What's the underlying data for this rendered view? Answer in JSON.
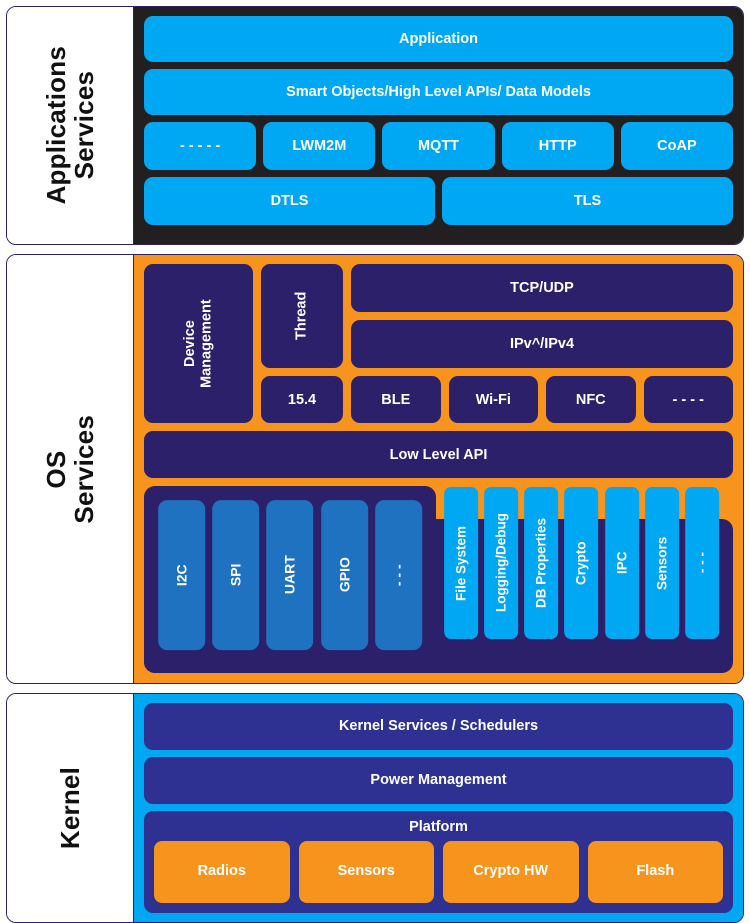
{
  "colors": {
    "cyan": "#00a8f3",
    "orange": "#f7941e",
    "navy": "#2b2069",
    "kernel_navy": "#2e3192",
    "peripheral_blue": "#1f72c0",
    "dark": "#231f20",
    "white": "#ffffff"
  },
  "layers": {
    "applications": {
      "label": "Applications\nServices",
      "application": "Application",
      "smart_objects": "Smart Objects/High Level APIs/ Data Models",
      "protocols": [
        "- - - - -",
        "LWM2M",
        "MQTT",
        "HTTP",
        "CoAP"
      ],
      "security": [
        "DTLS",
        "TLS"
      ]
    },
    "os": {
      "label": "OS\nServices",
      "device_management": "Device\nManagement",
      "thread": "Thread",
      "mac_154": "15.4",
      "transport": "TCP/UDP",
      "network": "IPv^/IPv4",
      "radios": [
        "BLE",
        "Wi-Fi",
        "NFC",
        "- - - -"
      ],
      "low_level_api": "Low Level API",
      "peripherals": [
        "I2C",
        "SPI",
        "UART",
        "GPIO",
        "- - -"
      ],
      "services": [
        "File System",
        "Logging/Debug",
        "DB Properties",
        "Crypto",
        "IPC",
        "Sensors",
        "- - -"
      ]
    },
    "kernel": {
      "label": "Kernel",
      "kernel_services": "Kernel Services / Schedulers",
      "power_management": "Power Management",
      "platform_title": "Platform",
      "platform_items": [
        "Radios",
        "Sensors",
        "Crypto HW",
        "Flash"
      ]
    }
  }
}
